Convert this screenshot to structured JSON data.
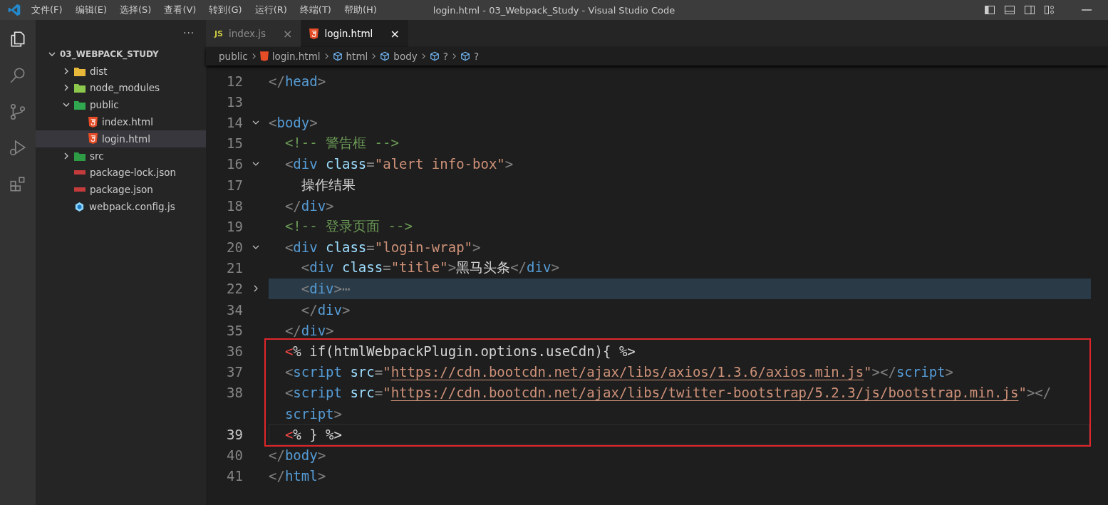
{
  "title_bar": {
    "menus": [
      "文件(F)",
      "编辑(E)",
      "选择(S)",
      "查看(V)",
      "转到(G)",
      "运行(R)",
      "终端(T)",
      "帮助(H)"
    ],
    "title": "login.html - 03_Webpack_Study - Visual Studio Code"
  },
  "activity_bar": [
    {
      "kind": "explorer",
      "selected": true
    },
    {
      "kind": "search",
      "selected": false
    },
    {
      "kind": "source-control",
      "selected": false
    },
    {
      "kind": "debug",
      "selected": false
    },
    {
      "kind": "extensions",
      "selected": false
    }
  ],
  "sidebar": {
    "more": "···",
    "tree": [
      {
        "label": "03_WEBPACK_STUDY",
        "kind": "root",
        "expanded": true,
        "selected": false,
        "children": [
          {
            "label": "dist",
            "kind": "dist",
            "expanded": false,
            "selected": false
          },
          {
            "label": "node_modules",
            "kind": "node",
            "expanded": false,
            "selected": false
          },
          {
            "label": "public",
            "kind": "public",
            "expanded": true,
            "selected": false,
            "children": [
              {
                "label": "index.html",
                "kind": "html",
                "selected": false
              },
              {
                "label": "login.html",
                "kind": "html",
                "selected": true
              }
            ]
          },
          {
            "label": "src",
            "kind": "src",
            "expanded": false,
            "selected": false
          },
          {
            "label": "package-lock.json",
            "kind": "npm",
            "selected": false
          },
          {
            "label": "package.json",
            "kind": "npm",
            "selected": false
          },
          {
            "label": "webpack.config.js",
            "kind": "webpack",
            "selected": false
          }
        ]
      }
    ]
  },
  "tabs": [
    {
      "label": "index.js",
      "kind": "js",
      "badge": "JS",
      "close": "×",
      "selected": false
    },
    {
      "label": "login.html",
      "kind": "html",
      "close": "×",
      "selected": true
    }
  ],
  "breadcrumb": [
    {
      "label": "public",
      "kind": "folder"
    },
    {
      "label": "login.html",
      "kind": "html"
    },
    {
      "label": "html",
      "kind": "element"
    },
    {
      "label": "body",
      "kind": "element"
    },
    {
      "label": "?",
      "kind": "element"
    },
    {
      "label": "?",
      "kind": "element"
    }
  ],
  "code": {
    "before": [
      {
        "n": "12",
        "current": false,
        "highlighted": false,
        "tokens": [
          {
            "kind": "p",
            "text": "</"
          },
          {
            "kind": "tag",
            "text": "head"
          },
          {
            "kind": "p",
            "text": ">"
          }
        ]
      },
      {
        "n": "13",
        "current": false,
        "highlighted": false
      },
      {
        "n": "14",
        "expanded": true,
        "current": false,
        "highlighted": false,
        "tokens": [
          {
            "kind": "p",
            "text": "<"
          },
          {
            "kind": "tag",
            "text": "body"
          },
          {
            "kind": "p",
            "text": ">"
          }
        ]
      },
      {
        "n": "15",
        "current": false,
        "highlighted": false,
        "tokens": [
          {
            "kind": "cm",
            "text": "  <!-- 警告框 -->"
          }
        ]
      },
      {
        "n": "16",
        "expanded": true,
        "current": false,
        "highlighted": false,
        "tokens": [
          {
            "kind": "p",
            "text": "  <"
          },
          {
            "kind": "tag",
            "text": "div"
          },
          {
            "kind": "attr",
            "text": " class"
          },
          {
            "kind": "p",
            "text": "="
          },
          {
            "kind": "str",
            "text": "\"alert info-box\""
          },
          {
            "kind": "p",
            "text": ">"
          }
        ]
      },
      {
        "n": "17",
        "current": false,
        "highlighted": false,
        "tokens": [
          {
            "kind": "tx",
            "text": "    操作结果"
          }
        ]
      },
      {
        "n": "18",
        "current": false,
        "highlighted": false,
        "tokens": [
          {
            "kind": "p",
            "text": "  </"
          },
          {
            "kind": "tag",
            "text": "div"
          },
          {
            "kind": "p",
            "text": ">"
          }
        ]
      },
      {
        "n": "19",
        "current": false,
        "highlighted": false,
        "tokens": [
          {
            "kind": "cm",
            "text": "  <!-- 登录页面 -->"
          }
        ]
      },
      {
        "n": "20",
        "expanded": true,
        "current": false,
        "highlighted": false,
        "tokens": [
          {
            "kind": "p",
            "text": "  <"
          },
          {
            "kind": "tag",
            "text": "div"
          },
          {
            "kind": "attr",
            "text": " class"
          },
          {
            "kind": "p",
            "text": "="
          },
          {
            "kind": "str",
            "text": "\"login-wrap\""
          },
          {
            "kind": "p",
            "text": ">"
          }
        ]
      },
      {
        "n": "21",
        "current": false,
        "highlighted": false,
        "tokens": [
          {
            "kind": "p",
            "text": "    <"
          },
          {
            "kind": "tag",
            "text": "div"
          },
          {
            "kind": "attr",
            "text": " class"
          },
          {
            "kind": "p",
            "text": "="
          },
          {
            "kind": "str",
            "text": "\"title\""
          },
          {
            "kind": "p",
            "text": ">"
          },
          {
            "kind": "tx",
            "text": "黑马头条"
          },
          {
            "kind": "p",
            "text": "</"
          },
          {
            "kind": "tag",
            "text": "div"
          },
          {
            "kind": "p",
            "text": ">"
          }
        ]
      },
      {
        "n": "22",
        "expanded": false,
        "current": false,
        "highlighted": true,
        "tokens": [
          {
            "kind": "p",
            "text": "    <"
          },
          {
            "kind": "tag",
            "text": "div"
          },
          {
            "kind": "p",
            "text": ">⋯"
          }
        ]
      },
      {
        "n": "34",
        "current": false,
        "highlighted": false,
        "tokens": [
          {
            "kind": "p",
            "text": "    </"
          },
          {
            "kind": "tag",
            "text": "div"
          },
          {
            "kind": "p",
            "text": ">"
          }
        ]
      },
      {
        "n": "35",
        "current": false,
        "highlighted": false,
        "tokens": [
          {
            "kind": "p",
            "text": "  </"
          },
          {
            "kind": "tag",
            "text": "div"
          },
          {
            "kind": "p",
            "text": ">"
          }
        ]
      }
    ],
    "framed": [
      {
        "n": "36",
        "current": false,
        "highlighted": false,
        "tokens": [
          {
            "kind": "ev",
            "text": "  <"
          },
          {
            "kind": "tx",
            "text": "% if(htmlWebpackPlugin.options.useCdn){ %>"
          }
        ]
      },
      {
        "n": "37",
        "current": false,
        "highlighted": false,
        "tokens": [
          {
            "kind": "p",
            "text": "  <"
          },
          {
            "kind": "tag",
            "text": "script"
          },
          {
            "kind": "attr",
            "text": " src"
          },
          {
            "kind": "p",
            "text": "="
          },
          {
            "kind": "str",
            "text": "\""
          },
          {
            "kind": "url",
            "text": "https://cdn.bootcdn.net/ajax/libs/axios/1.3.6/axios.min.js"
          },
          {
            "kind": "str",
            "text": "\""
          },
          {
            "kind": "p",
            "text": "></"
          },
          {
            "kind": "tag",
            "text": "script"
          },
          {
            "kind": "p",
            "text": ">"
          }
        ]
      },
      {
        "n": "38",
        "current": false,
        "highlighted": false,
        "tokens": [
          {
            "kind": "p",
            "text": "  <"
          },
          {
            "kind": "tag",
            "text": "script"
          },
          {
            "kind": "attr",
            "text": " src"
          },
          {
            "kind": "p",
            "text": "="
          },
          {
            "kind": "str",
            "text": "\""
          },
          {
            "kind": "url",
            "text": "https://cdn.bootcdn.net/ajax/libs/twitter-bootstrap/5.2.3/js/bootstrap.min.js"
          },
          {
            "kind": "str",
            "text": "\""
          },
          {
            "kind": "p",
            "text": "></"
          }
        ]
      },
      {
        "current": false,
        "highlighted": false,
        "tokens": [
          {
            "kind": "tag",
            "text": "  script"
          },
          {
            "kind": "p",
            "text": ">"
          }
        ]
      },
      {
        "n": "39",
        "current": true,
        "highlighted": false,
        "tokens": [
          {
            "kind": "ev",
            "text": "  <"
          },
          {
            "kind": "tx",
            "text": "% } %>"
          }
        ]
      }
    ],
    "after": [
      {
        "n": "40",
        "current": false,
        "highlighted": false,
        "tokens": [
          {
            "kind": "p",
            "text": "</"
          },
          {
            "kind": "tag",
            "text": "body"
          },
          {
            "kind": "p",
            "text": ">"
          }
        ]
      },
      {
        "n": "41",
        "current": false,
        "highlighted": false,
        "tokens": [
          {
            "kind": "p",
            "text": "</"
          },
          {
            "kind": "tag",
            "text": "html"
          },
          {
            "kind": "p",
            "text": ">"
          }
        ]
      }
    ]
  }
}
